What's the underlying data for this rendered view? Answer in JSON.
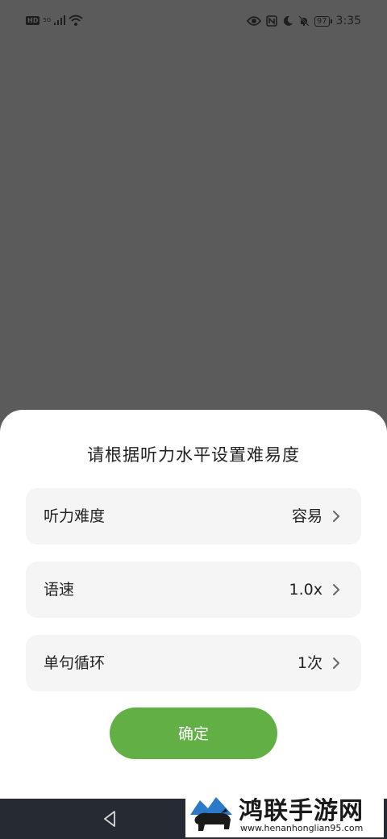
{
  "status_bar": {
    "hd_badge": "HD",
    "network": "5G",
    "battery": "97",
    "time": "3:35",
    "icons": [
      "hd-icon",
      "signal-icon",
      "wifi-icon",
      "eye-icon",
      "nfc-icon",
      "moon-icon",
      "bell-off-icon",
      "battery-icon"
    ]
  },
  "sheet": {
    "title": "请根据听力水平设置难易度",
    "rows": [
      {
        "label": "听力难度",
        "value": "容易"
      },
      {
        "label": "语速",
        "value": "1.0x"
      },
      {
        "label": "单句循环",
        "value": "1次"
      }
    ],
    "confirm_label": "确定"
  },
  "nav_bar": {
    "icons": [
      "back-icon"
    ]
  },
  "watermark": {
    "title": "鸿联手游网",
    "url": "www.henanhonglian95.com"
  },
  "colors": {
    "scrim": "#5b5b5b",
    "sheet_bg": "#ffffff",
    "row_bg": "#f5f5f5",
    "accent_green": "#62b045",
    "nav_bar": "#262b33"
  }
}
